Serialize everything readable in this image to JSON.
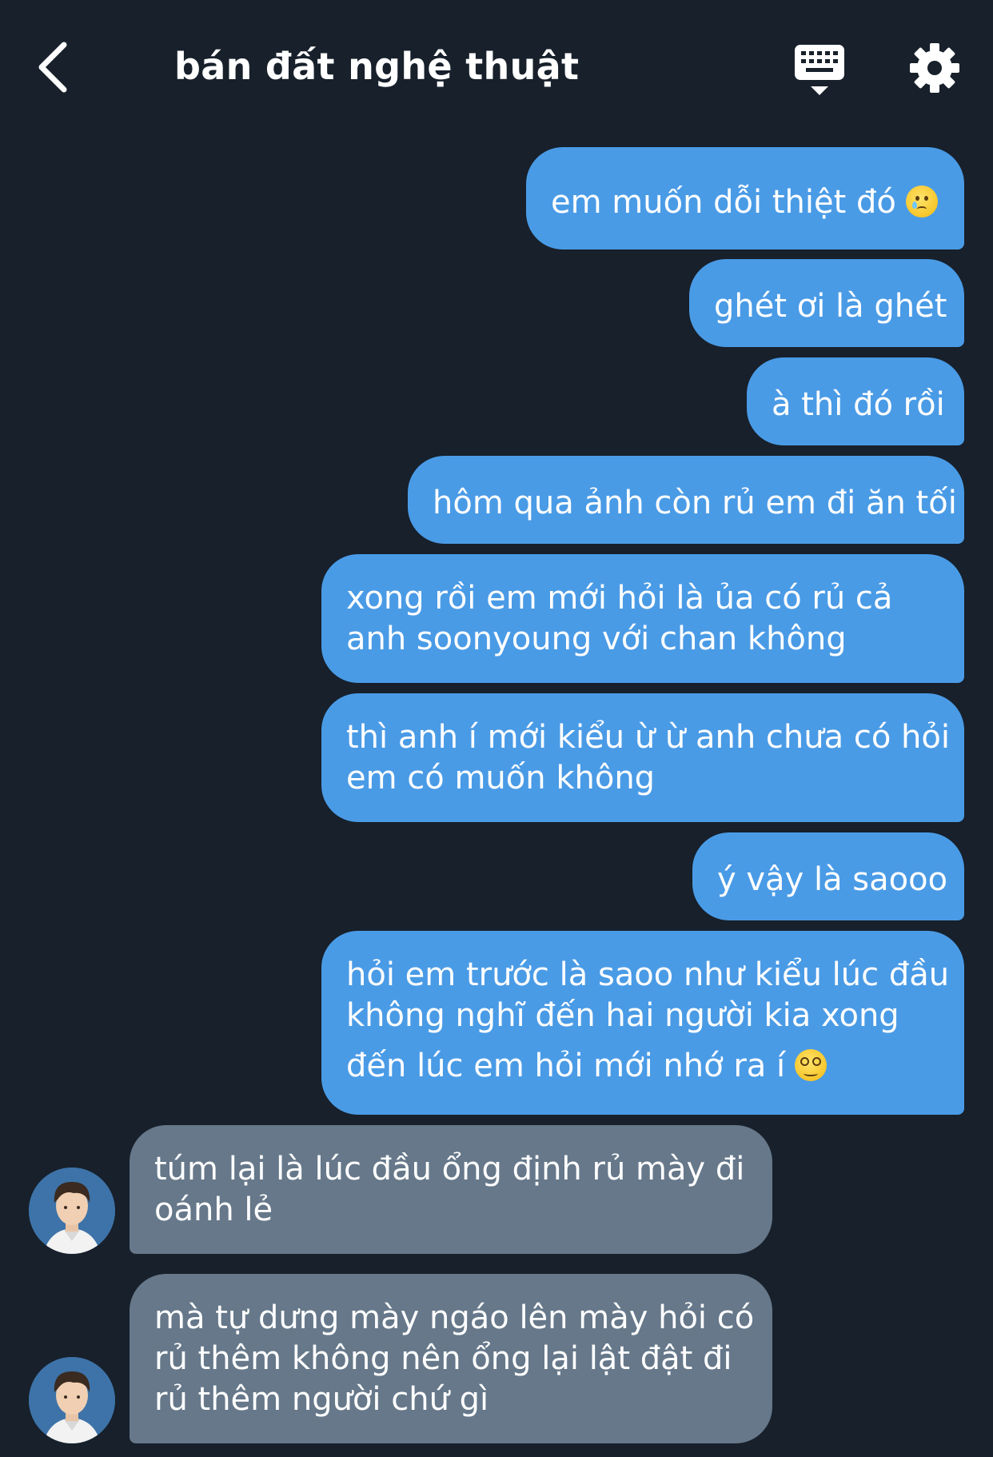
{
  "header": {
    "title": "bán đất nghệ thuật",
    "back_icon": "chevron-left-icon",
    "keyboard_icon": "keyboard-icon",
    "settings_icon": "gear-icon"
  },
  "colors": {
    "background": "#17202b",
    "sent_bubble": "#4a9be6",
    "received_bubble": "#66788a",
    "text": "#ffffff"
  },
  "messages": [
    {
      "from": "me",
      "lines": [
        "em muốn dỗi thiệt đó"
      ],
      "emoji": "crying-face"
    },
    {
      "from": "me",
      "lines": [
        "ghét ơi là ghét"
      ]
    },
    {
      "from": "me",
      "lines": [
        "à thì đó rồi"
      ]
    },
    {
      "from": "me",
      "lines": [
        "hôm qua ảnh còn rủ em đi ăn tối"
      ]
    },
    {
      "from": "me",
      "lines": [
        "xong rồi em mới hỏi là ủa có rủ cả",
        "anh soonyoung với chan không"
      ]
    },
    {
      "from": "me",
      "lines": [
        "thì anh í mới kiểu ừ ừ anh chưa có hỏi",
        "em có muốn không"
      ]
    },
    {
      "from": "me",
      "lines": [
        "ý vậy là saooo"
      ]
    },
    {
      "from": "me",
      "lines": [
        "hỏi em trước là saoo như kiểu lúc đầu",
        "không nghĩ đến hai người kia xong",
        "đến lúc em hỏi mới nhớ ra í"
      ],
      "emoji": "dizzy-face"
    },
    {
      "from": "other",
      "lines": [
        "túm lại là lúc đầu ổng định rủ mày đi",
        "oánh lẻ"
      ]
    },
    {
      "from": "other",
      "lines": [
        "mà tự dưng mày ngáo lên mày hỏi có",
        "rủ thêm không nên ổng lại lật đật đi",
        "rủ thêm người chứ gì"
      ]
    }
  ]
}
